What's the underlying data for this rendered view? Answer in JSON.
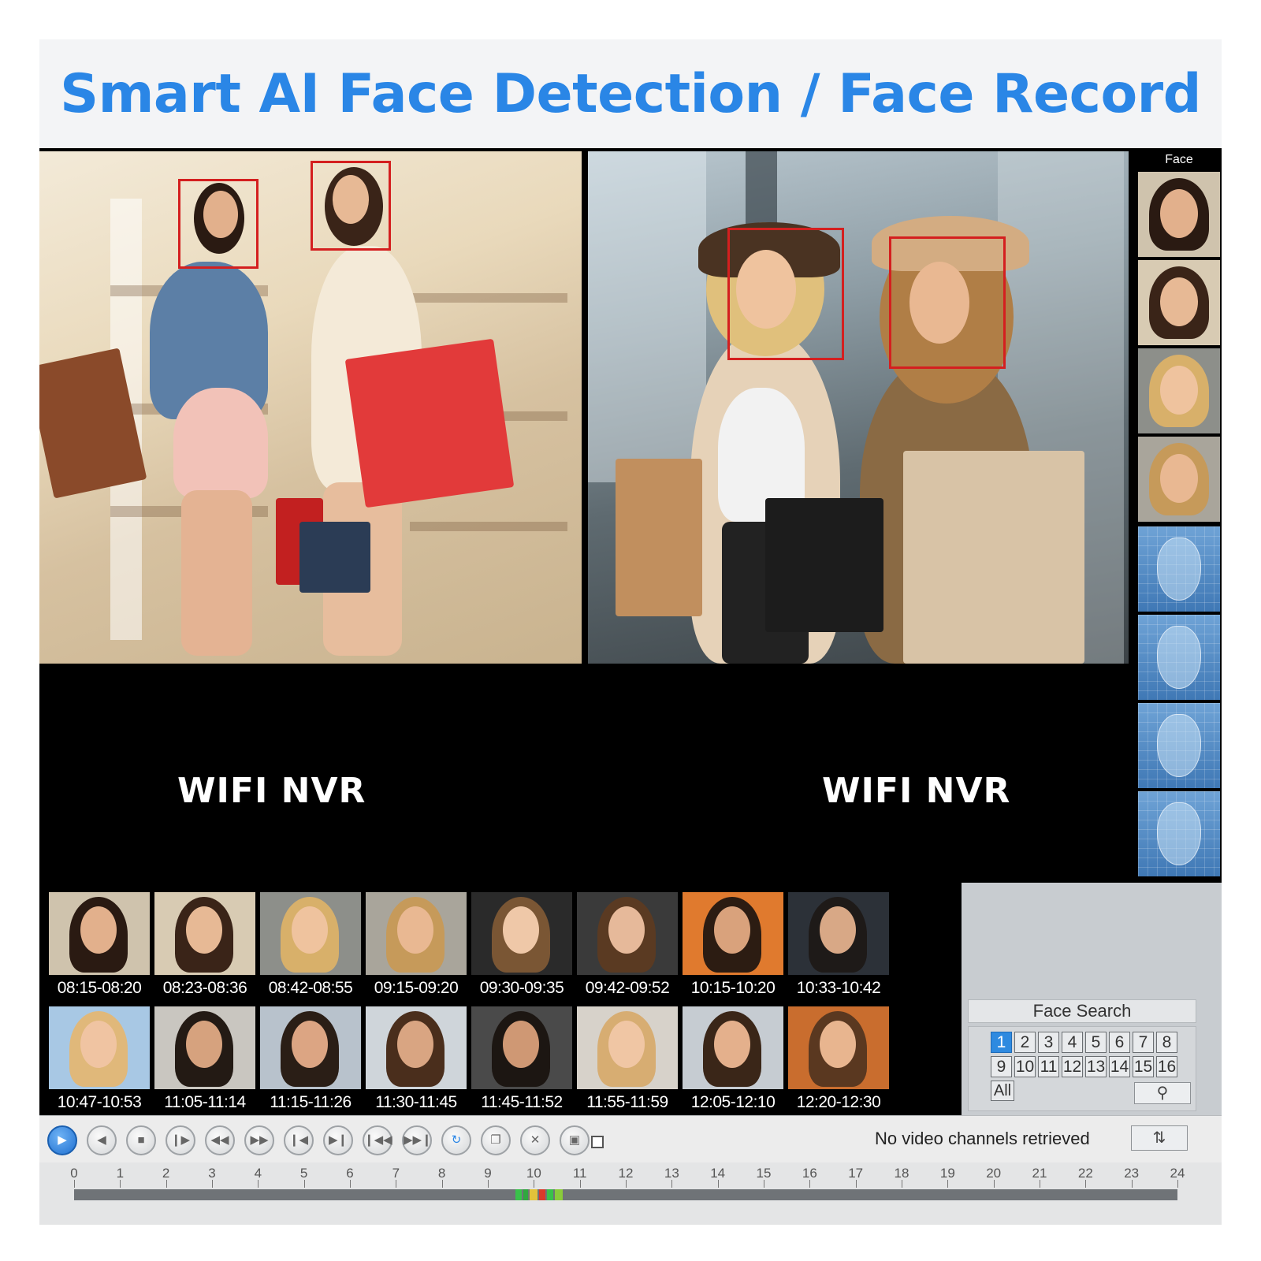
{
  "banner": {
    "title": "Smart AI Face Detection / Face Record"
  },
  "cameras": [
    {
      "label": "WIFI NVR"
    },
    {
      "label": "WIFI NVR"
    }
  ],
  "face_strip": {
    "title": "Face"
  },
  "records": [
    {
      "time": "08:15-08:20",
      "skin": "#e2b08c",
      "hair": "#2a1a12",
      "bg": "#cfc3ad"
    },
    {
      "time": "08:23-08:36",
      "skin": "#e7b995",
      "hair": "#3a2418",
      "bg": "#d8cbb3"
    },
    {
      "time": "08:42-08:55",
      "skin": "#efc39e",
      "hair": "#d8b06a",
      "bg": "#8d8f8a"
    },
    {
      "time": "09:15-09:20",
      "skin": "#e9b892",
      "hair": "#c69a5a",
      "bg": "#a9a59b"
    },
    {
      "time": "09:30-09:35",
      "skin": "#efc8a8",
      "hair": "#7a5634",
      "bg": "#2a2a2a"
    },
    {
      "time": "09:42-09:52",
      "skin": "#e6b99a",
      "hair": "#5a3a22",
      "bg": "#3a3a3a"
    },
    {
      "time": "10:15-10:20",
      "skin": "#d9a27c",
      "hair": "#2c1c12",
      "bg": "#e07a2e"
    },
    {
      "time": "10:33-10:42",
      "skin": "#d8a886",
      "hair": "#1e1a18",
      "bg": "#2c3138"
    },
    {
      "time": "10:47-10:53",
      "skin": "#f0c4a2",
      "hair": "#e0b87a",
      "bg": "#a8c8e4"
    },
    {
      "time": "11:05-11:14",
      "skin": "#d6a27e",
      "hair": "#231a14",
      "bg": "#c9c6c0"
    },
    {
      "time": "11:15-11:26",
      "skin": "#dca583",
      "hair": "#2a1e16",
      "bg": "#b8c2cc"
    },
    {
      "time": "11:30-11:45",
      "skin": "#d9a582",
      "hair": "#4a2e1c",
      "bg": "#cfd5da"
    },
    {
      "time": "11:45-11:52",
      "skin": "#cf9874",
      "hair": "#1c1612",
      "bg": "#4a4a4a"
    },
    {
      "time": "11:55-11:59",
      "skin": "#f0c6a4",
      "hair": "#d7ad72",
      "bg": "#d7d2ca"
    },
    {
      "time": "12:05-12:10",
      "skin": "#e4b08c",
      "hair": "#3a2618",
      "bg": "#c6ccd2"
    },
    {
      "time": "12:20-12:30",
      "skin": "#e8b58f",
      "hair": "#5a3820",
      "bg": "#c96d2e"
    }
  ],
  "face_search": {
    "title": "Face Search",
    "channels": [
      "1",
      "2",
      "3",
      "4",
      "5",
      "6",
      "7",
      "8",
      "9",
      "10",
      "11",
      "12",
      "13",
      "14",
      "15",
      "16"
    ],
    "active_channel": "1",
    "all_label": "All",
    "search_icon": "magnifier-icon"
  },
  "playback": {
    "status": "No video channels retrieved",
    "controls": [
      "play",
      "prev-frame",
      "stop",
      "next-frame",
      "rewind",
      "fast-forward",
      "skip-start",
      "skip-end",
      "jump-back",
      "jump-forward",
      "loop",
      "copy",
      "cut",
      "save"
    ],
    "refresh_icon": "refresh-arrows-icon"
  },
  "timeline": {
    "hours": [
      "0",
      "1",
      "2",
      "3",
      "4",
      "5",
      "6",
      "7",
      "8",
      "9",
      "10",
      "11",
      "12",
      "13",
      "14",
      "15",
      "16",
      "17",
      "18",
      "19",
      "20",
      "21",
      "22",
      "23",
      "24"
    ]
  },
  "colors": {
    "accent": "#2a86e6",
    "face_box": "#d41f1f",
    "active_channel": "#2e8ae0"
  }
}
